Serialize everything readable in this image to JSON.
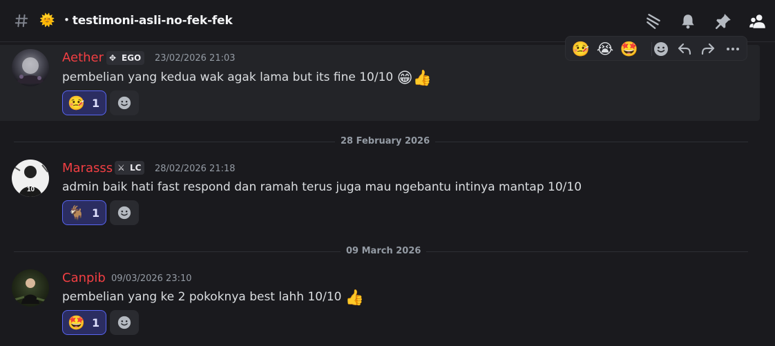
{
  "header": {
    "channel_emoji": "🌞",
    "channel_name": "・testimoni-asli-no-fek-fek",
    "icons": [
      "threads-icon",
      "bell-icon",
      "pin-icon",
      "members-icon"
    ]
  },
  "toolbar": {
    "reactions": [
      "🤒",
      "😭",
      "🤩"
    ],
    "actions": [
      "add-reaction-icon",
      "reply-icon",
      "forward-icon",
      "more-icon"
    ]
  },
  "dividers": [
    "28 February 2026",
    "09 March 2026"
  ],
  "messages": [
    {
      "username": "Aether",
      "tag": "EGO",
      "tag_icon": "✥",
      "timestamp": "23/02/2026 21:03",
      "text": "pembelian yang kedua wak agak lama but its fine 10/10",
      "inline_emojis": "😁👍",
      "reaction": {
        "emoji": "🤒",
        "count": "1"
      }
    },
    {
      "username": "Marasss",
      "tag": "LC",
      "tag_icon": "⚔",
      "timestamp": "28/02/2026 21:18",
      "text": "admin baik hati fast respond dan ramah terus juga mau ngebantu intinya mantap 10/10",
      "inline_emojis": "",
      "reaction": {
        "emoji": "🐐",
        "count": "1"
      }
    },
    {
      "username": "Canpib",
      "timestamp": "09/03/2026 23:10",
      "text": "pembelian yang ke 2  pokoknya best lahh 10/10",
      "inline_emojis": "👍",
      "reaction": {
        "emoji": "🤩",
        "count": "1"
      }
    }
  ],
  "colors": {
    "background": "#1a1a1e",
    "username": "#f23f43",
    "reaction_bg": "#2b2d61",
    "reaction_border": "#5865f2"
  }
}
